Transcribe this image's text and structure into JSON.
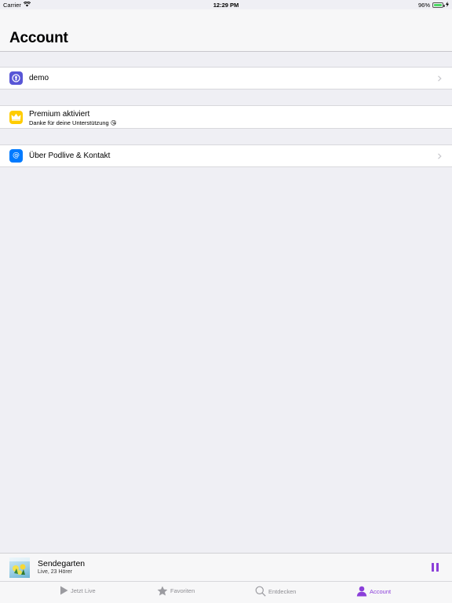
{
  "status_bar": {
    "carrier": "Carrier",
    "time": "12:29 PM",
    "battery": "96%",
    "battery_level": 0.96
  },
  "header": {
    "title": "Account"
  },
  "account": {
    "user_label": "demo",
    "premium_label": "Premium aktiviert",
    "premium_sub": "Danke für deine Unterstützung 😘",
    "about_label": "Über Podlive & Kontakt"
  },
  "now_playing": {
    "title": "Sendegarten",
    "subtitle": "Live, 23 Hörer",
    "state": "playing"
  },
  "tabs": [
    {
      "label": "Jetzt Live",
      "icon": "play-icon",
      "active": false
    },
    {
      "label": "Favoriten",
      "icon": "star-icon",
      "active": false
    },
    {
      "label": "Entdecken",
      "icon": "search-icon",
      "active": false
    },
    {
      "label": "Account",
      "icon": "person-icon",
      "active": true
    }
  ],
  "colors": {
    "accent": "#8b3fd9",
    "user_icon_bg": "#5856d6",
    "premium_icon_bg": "#ffcc00",
    "about_icon_bg": "#007aff"
  }
}
